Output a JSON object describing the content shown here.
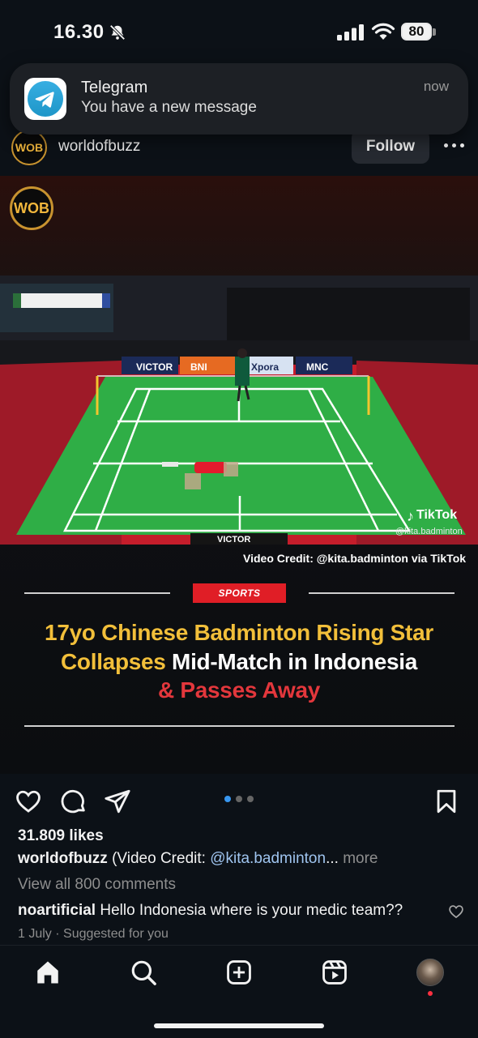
{
  "status_bar": {
    "time": "16.30",
    "battery": "80",
    "icons": [
      "bell-slash-icon",
      "signal-icon",
      "wifi-icon",
      "battery-icon"
    ]
  },
  "notification": {
    "app": "Telegram",
    "message": "You have a new message",
    "time": "now",
    "icon": "telegram-icon"
  },
  "post": {
    "username": "worldofbuzz",
    "avatar_text": "WOB",
    "follow_label": "Follow",
    "media": {
      "watermark": "WOB",
      "tiktok_label": "TikTok",
      "tiktok_handle": "@kita.badminton",
      "video_credit": "Video Credit: @kita.badminton via TikTok",
      "category": "SPORTS",
      "headline_line1": "17yo Chinese Badminton Rising Star",
      "headline_line2_a": "Collapses",
      "headline_line2_b": " Mid-Match in Indonesia",
      "headline_line3": "& Passes Away",
      "court_ads": [
        "VICTOR",
        "BNI",
        "Xpora",
        "MNC",
        "VICTOR"
      ],
      "carousel_total": 3,
      "carousel_active": 1
    },
    "likes": "31.809 likes",
    "caption_user": "worldofbuzz",
    "caption_text": " (Video Credit: ",
    "caption_handle": "@kita.badminton",
    "caption_ellipsis": "...",
    "caption_more": " more",
    "view_comments": "View all 800 comments",
    "comment_user": "noartificial",
    "comment_text": " Hello Indonesia where is your medic team??",
    "date": "1 July",
    "separator": " · ",
    "suggested": "Suggested for you"
  },
  "colors": {
    "background": "#0c1117",
    "accent_gold": "#f2bf3a",
    "accent_red": "#e3373c",
    "telegram_blue": "#2aa3dd",
    "link_blue": "#9fc4ef"
  },
  "bottom_nav": [
    "home-icon",
    "search-icon",
    "create-icon",
    "reels-icon",
    "profile-avatar"
  ]
}
